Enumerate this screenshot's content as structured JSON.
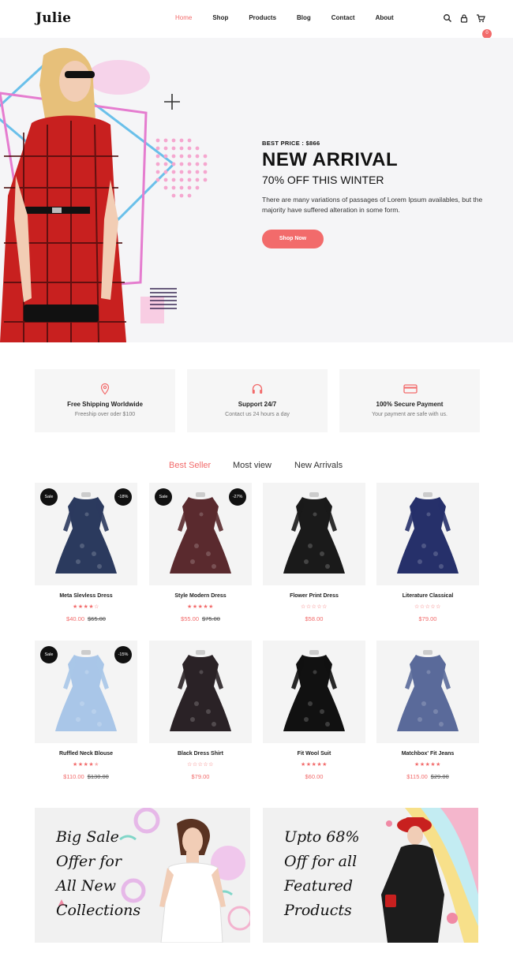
{
  "header": {
    "logo": "Julie",
    "nav": [
      {
        "label": "Home",
        "active": true
      },
      {
        "label": "Shop",
        "active": false
      },
      {
        "label": "Products",
        "active": false
      },
      {
        "label": "Blog",
        "active": false
      },
      {
        "label": "Contact",
        "active": false
      },
      {
        "label": "About",
        "active": false
      }
    ],
    "icons": [
      "search-icon",
      "lock-icon",
      "cart-icon"
    ],
    "cart_count": "0"
  },
  "hero": {
    "best_price": "BEST PRICE : $866",
    "title": "NEW ARRIVAL",
    "subtitle": "70% OFF THIS WINTER",
    "description": "There are many variations of passages of Lorem Ipsum availables, but the majority have suffered alteration in some form.",
    "button": "Shop Now"
  },
  "features": [
    {
      "icon": "location-pin-icon",
      "title": "Free Shipping Worldwide",
      "subtitle": "Freeship over oder $100"
    },
    {
      "icon": "headphones-icon",
      "title": "Support 24/7",
      "subtitle": "Contact us 24 hours a day"
    },
    {
      "icon": "credit-card-icon",
      "title": "100% Secure Payment",
      "subtitle": "Your payment are safe with us."
    }
  ],
  "tabs": [
    {
      "label": "Best Seller",
      "active": true
    },
    {
      "label": "Most view",
      "active": false
    },
    {
      "label": "New Arrivals",
      "active": false
    }
  ],
  "products": [
    {
      "name": "Meta Slevless Dress",
      "rating": 4,
      "price": "$40.00",
      "old_price": "$65.00",
      "sale": "Sale",
      "discount": "-18%",
      "dress_color": "#2b3a5e"
    },
    {
      "name": "Style Modern Dress",
      "rating": 5,
      "price": "$55.00",
      "old_price": "$75.00",
      "sale": "Sale",
      "discount": "-27%",
      "dress_color": "#5a2a2e"
    },
    {
      "name": "Flower Print Dress",
      "rating": 0,
      "price": "$58.00",
      "old_price": "",
      "sale": "",
      "discount": "",
      "dress_color": "#1a1a1a"
    },
    {
      "name": "Literature Classical",
      "rating": 0,
      "price": "$79.00",
      "old_price": "",
      "sale": "",
      "discount": "",
      "dress_color": "#26306a"
    },
    {
      "name": "Ruffled Neck Blouse",
      "rating": 4.5,
      "price": "$110.00",
      "old_price": "$130.00",
      "sale": "Sale",
      "discount": "-15%",
      "dress_color": "#a9c6e8"
    },
    {
      "name": "Black Dress Shirt",
      "rating": 0,
      "price": "$79.00",
      "old_price": "",
      "sale": "",
      "discount": "",
      "dress_color": "#2a2226"
    },
    {
      "name": "Fit Wool Suit",
      "rating": 5,
      "price": "$60.00",
      "old_price": "",
      "sale": "",
      "discount": "",
      "dress_color": "#111111"
    },
    {
      "name": "Matchbox' Fit Jeans",
      "rating": 5,
      "price": "$115.00",
      "old_price": "$29.00",
      "sale": "",
      "discount": "",
      "dress_color": "#5a6a9a"
    }
  ],
  "banners": [
    {
      "text_lines": [
        "Big Sale",
        "Offer for",
        "All New",
        "Collections"
      ]
    },
    {
      "text_lines": [
        "Upto 68%",
        "Off for all",
        "Featured",
        "Products"
      ]
    }
  ],
  "colors": {
    "accent": "#f26b6b",
    "hero_bg": "#f5f5f7",
    "card_bg": "#f4f4f4",
    "star": "#f26b6b"
  }
}
